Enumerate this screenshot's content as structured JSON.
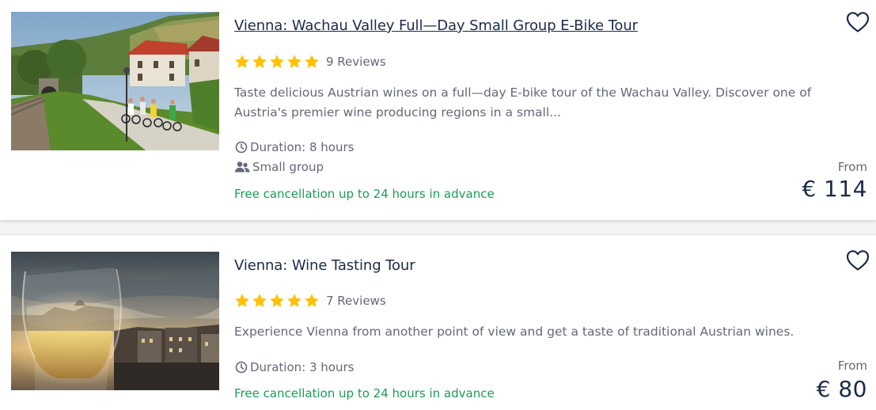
{
  "listings": [
    {
      "title": "Vienna: Wachau Valley Full—Day Small Group E-Bike Tour",
      "rating_stars": 5,
      "reviews": "9 Reviews",
      "description_lines": [
        "Taste delicious Austrian wines on a full—day E-bike tour of the Wachau Valley. Discover one of",
        "Austria's premier wine producing regions in a small..."
      ],
      "duration": "Duration: 8 hours",
      "group": "Small group",
      "cancellation": "Free cancellation up to 24 hours in advance",
      "price_from": "From",
      "price": "€ 114",
      "image_icon": "vineyard-village-photo",
      "wishlist_icon": "heart-outline-icon"
    },
    {
      "title": "Vienna: Wine Tasting Tour",
      "rating_stars": 5,
      "reviews": "7 Reviews",
      "description_lines": [
        "Experience Vienna from another point of view and get a taste of traditional Austrian wines."
      ],
      "duration": "Duration: 3 hours",
      "cancellation": "Free cancellation up to 24 hours in advance",
      "price_from": "From",
      "price": "€ 80",
      "image_icon": "wine-glass-city-photo",
      "wishlist_icon": "heart-outline-icon"
    }
  ],
  "colors": {
    "title": "#1a2b49",
    "text": "#63687a",
    "star": "#ffc107",
    "cancellation": "#1a9e56",
    "price": "#1a2b49"
  }
}
